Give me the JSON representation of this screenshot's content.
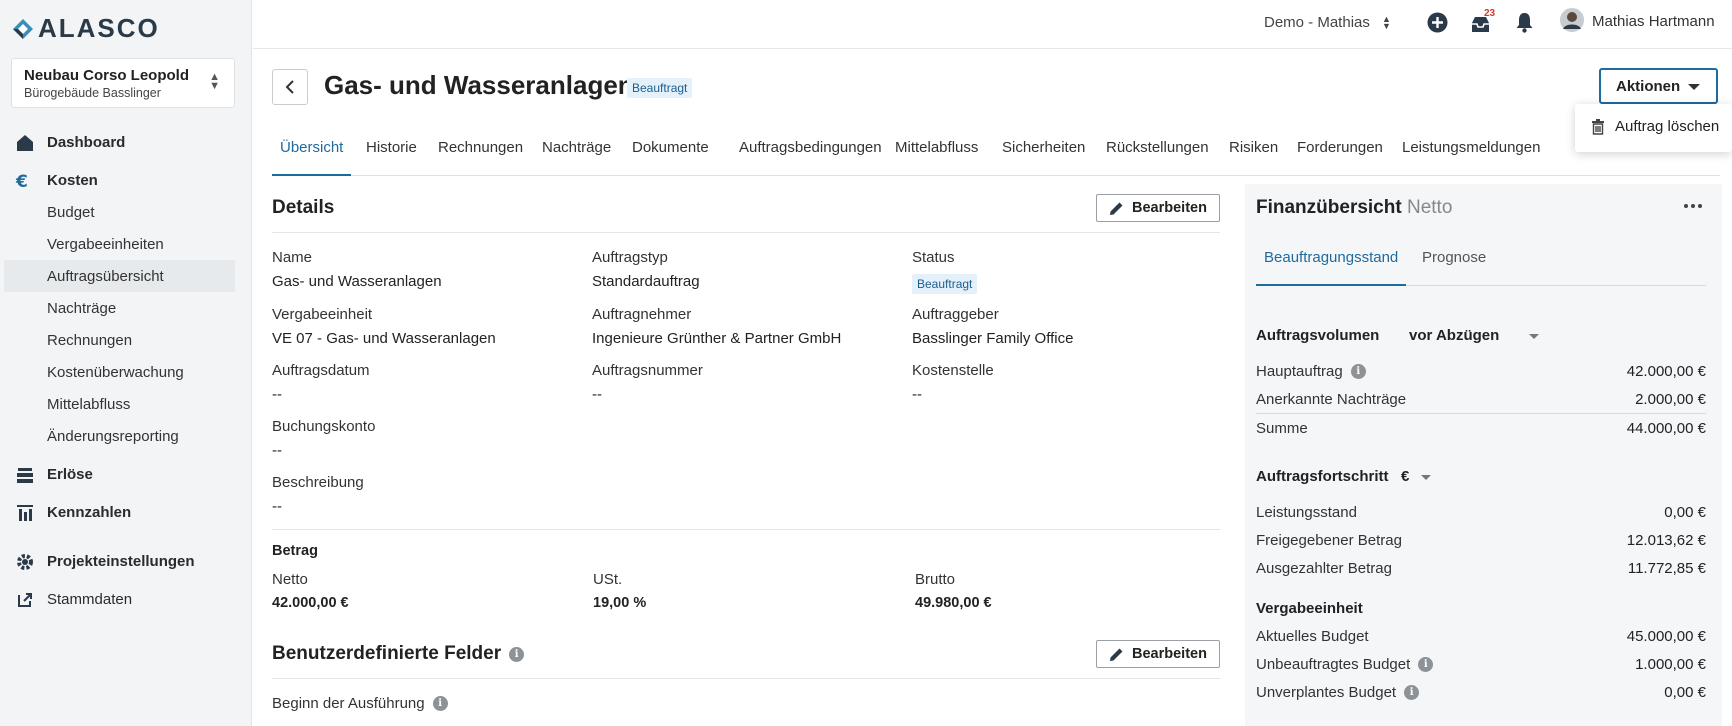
{
  "app": {
    "logo": "ALASCO"
  },
  "project": {
    "name": "Neubau Corso Leopold",
    "sub": "Bürogebäude Basslinger"
  },
  "sidebar": {
    "dashboard": "Dashboard",
    "kosten": "Kosten",
    "sub": [
      "Budget",
      "Vergabeeinheiten",
      "Auftragsübersicht",
      "Nachträge",
      "Rechnungen",
      "Kostenüberwachung",
      "Mittelabfluss",
      "Änderungsreporting"
    ],
    "erloese": "Erlöse",
    "kennzahlen": "Kennzahlen",
    "projekteinstellungen": "Projekteinstellungen",
    "stammdaten": "Stammdaten"
  },
  "topbar": {
    "workspace": "Demo - Mathias",
    "notif_count": "23",
    "user": "Mathias Hartmann"
  },
  "header": {
    "title": "Gas- und Wasseranlagen",
    "status": "Beauftragt",
    "actions": "Aktionen",
    "menu_delete": "Auftrag löschen"
  },
  "tabs": [
    "Übersicht",
    "Historie",
    "Rechnungen",
    "Nachträge",
    "Dokumente",
    "Auftragsbedingungen",
    "Mittelabfluss",
    "Sicherheiten",
    "Rückstellungen",
    "Risiken",
    "Forderungen",
    "Leistungsmeldungen"
  ],
  "details": {
    "title": "Details",
    "edit": "Bearbeiten",
    "name_label": "Name",
    "name": "Gas- und Wasseranlagen",
    "type_label": "Auftragstyp",
    "type": "Standardauftrag",
    "status_label": "Status",
    "status": "Beauftragt",
    "unit_label": "Vergabeeinheit",
    "unit": "VE 07 - Gas- und Wasseranlagen",
    "contractor_label": "Auftragnehmer",
    "contractor": "Ingenieure Grünther & Partner GmbH",
    "client_label": "Auftraggeber",
    "client": "Basslinger Family Office",
    "date_label": "Auftragsdatum",
    "date": "--",
    "number_label": "Auftragsnummer",
    "number": "--",
    "cost_center_label": "Kostenstelle",
    "cost_center": "--",
    "account_label": "Buchungskonto",
    "account": "--",
    "description_label": "Beschreibung",
    "description": "--"
  },
  "betrag": {
    "title": "Betrag",
    "netto_label": "Netto",
    "netto": "42.000,00 €",
    "ust_label": "USt.",
    "ust": "19,00 %",
    "brutto_label": "Brutto",
    "brutto": "49.980,00 €"
  },
  "custom": {
    "title": "Benutzerdefinierte Felder",
    "edit": "Bearbeiten",
    "start_label": "Beginn der Ausführung"
  },
  "finance": {
    "title": "Finanzübersicht",
    "suffix": "Netto",
    "tab_active": "Beauftragungsstand",
    "tab2": "Prognose",
    "volume_label": "Auftragsvolumen",
    "volume_select": "vor Abzügen",
    "main_label": "Hauptauftrag",
    "main": "42.000,00 €",
    "changes_label": "Anerkannte Nachträge",
    "changes": "2.000,00 €",
    "sum_label": "Summe",
    "sum": "44.000,00 €",
    "progress_label": "Auftragsfortschritt",
    "progress_unit": "€",
    "performance_label": "Leistungsstand",
    "performance": "0,00 €",
    "released_label": "Freigegebener Betrag",
    "released": "12.013,62 €",
    "paid_label": "Ausgezahlter Betrag",
    "paid": "11.772,85 €",
    "unit_label": "Vergabeeinheit",
    "budget_label": "Aktuelles Budget",
    "budget": "45.000,00 €",
    "unassigned_label": "Unbeauftragtes Budget",
    "unassigned": "1.000,00 €",
    "unplanned_label": "Unverplantes Budget",
    "unplanned": "0,00 €"
  }
}
